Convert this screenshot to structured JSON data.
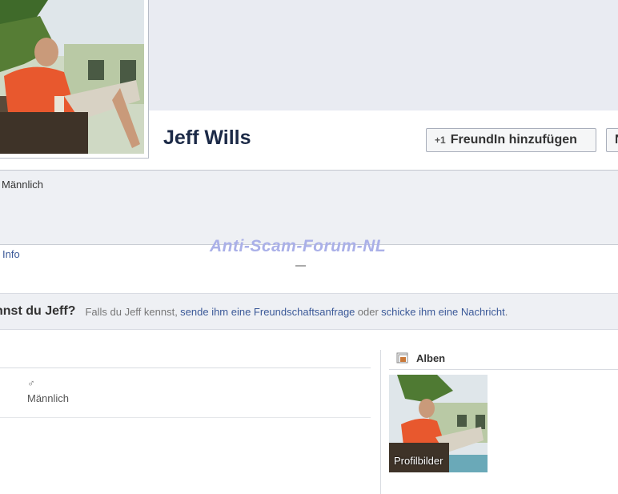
{
  "profile": {
    "name": "Jeff Wills",
    "add_friend_label": "FreundIn hinzufügen",
    "add_friend_icon": "+1",
    "message_label": "N",
    "gender": "Männlich"
  },
  "tabs": {
    "info": "Info"
  },
  "watermark": "Anti-Scam-Forum-NL",
  "know_bar": {
    "question": "nnst du Jeff?",
    "text_1": "Falls du Jeff kennst,",
    "link_1": "sende ihm eine Freundschaftsanfrage",
    "text_2": "oder",
    "link_2": "schicke ihm eine Nachricht",
    "text_3": "."
  },
  "basic_info": {
    "gender_symbol": "♂",
    "gender": "Männlich"
  },
  "albums": {
    "title": "Alben",
    "items": [
      {
        "label": "Profilbilder"
      }
    ]
  },
  "colors": {
    "link": "#3b5998",
    "name": "#1c2a47",
    "bar": "#eef0f4"
  }
}
